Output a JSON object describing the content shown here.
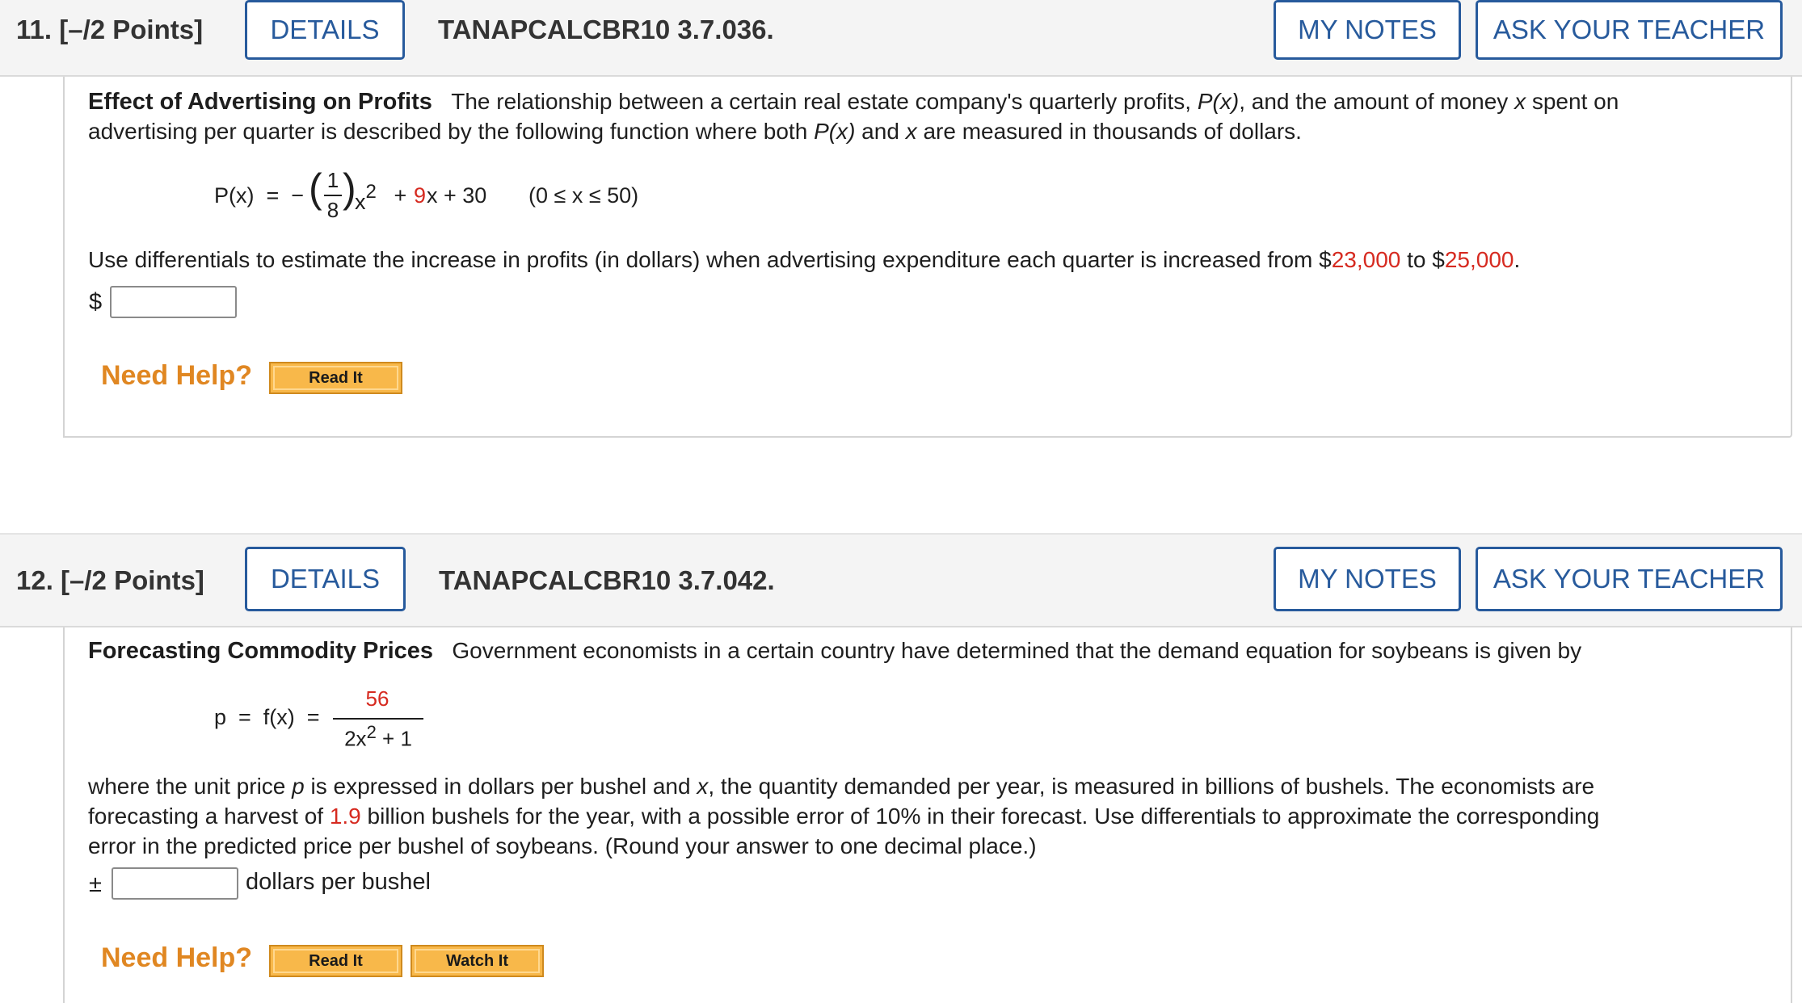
{
  "q11": {
    "number": "11.",
    "points": "[–/2 Points]",
    "details_label": "DETAILS",
    "code": "TANAPCALCBR10 3.7.036.",
    "mynotes_label": "MY NOTES",
    "ask_label": "ASK YOUR TEACHER",
    "title": "Effect of Advertising on Profits",
    "intro_a": "The relationship between a certain real estate company's quarterly profits, ",
    "intro_Px": "P(x)",
    "intro_b": ", and the amount of money ",
    "intro_x": "x",
    "intro_c": " spent on",
    "intro_line2a": "advertising per quarter is described by the following function where both ",
    "intro_line2_Px": "P(x)",
    "intro_line2b": " and ",
    "intro_line2_x": "x",
    "intro_line2c": " are measured in thousands of dollars.",
    "formula_lhs": "P(x)  =  −",
    "formula_num": "1",
    "formula_den": "8",
    "formula_x2": "x",
    "formula_sup": "2",
    "formula_plus1": " + ",
    "formula_coef": "9",
    "formula_rest": "x + 30",
    "formula_domain": "(0 ≤ x ≤ 50)",
    "question_a": "Use differentials to estimate the increase in profits (in dollars) when advertising expenditure each quarter is increased from $",
    "question_v1": "23,000",
    "question_b": " to $",
    "question_v2": "25,000",
    "question_c": ".",
    "answer_prefix": "$",
    "answer_value": "",
    "need_help": "Need Help?",
    "read_it": "Read It"
  },
  "q12": {
    "number": "12.",
    "points": "[–/2 Points]",
    "details_label": "DETAILS",
    "code": "TANAPCALCBR10 3.7.042.",
    "mynotes_label": "MY NOTES",
    "ask_label": "ASK YOUR TEACHER",
    "title": "Forecasting Commodity Prices",
    "intro": "Government economists in a certain country have determined that the demand equation for soybeans is given by",
    "formula_lhs": "p  =  f(x)  =",
    "formula_num": "56",
    "formula_den_a": "2x",
    "formula_den_sup": "2",
    "formula_den_b": " + 1",
    "para_l1a": "where the unit price ",
    "para_l1p": "p",
    "para_l1b": " is expressed in dollars per bushel and ",
    "para_l1x": "x",
    "para_l1c": ", the quantity demanded per year, is measured in billions of bushels. The economists are",
    "para_l2a": "forecasting a harvest of ",
    "para_l2v": "1.9",
    "para_l2b": " billion bushels for the year, with a possible error of 10% in their forecast. Use differentials to approximate the corresponding",
    "para_l3": "error in the predicted price per bushel of soybeans. (Round your answer to one decimal place.)",
    "answer_prefix": "±",
    "answer_value": "",
    "answer_suffix": "dollars per bushel",
    "need_help": "Need Help?",
    "read_it": "Read It",
    "watch_it": "Watch It"
  },
  "colors": {
    "accent_blue": "#275a9c",
    "value_red": "#d62a20",
    "help_orange": "#e08722",
    "button_gold": "#f8b84a"
  }
}
